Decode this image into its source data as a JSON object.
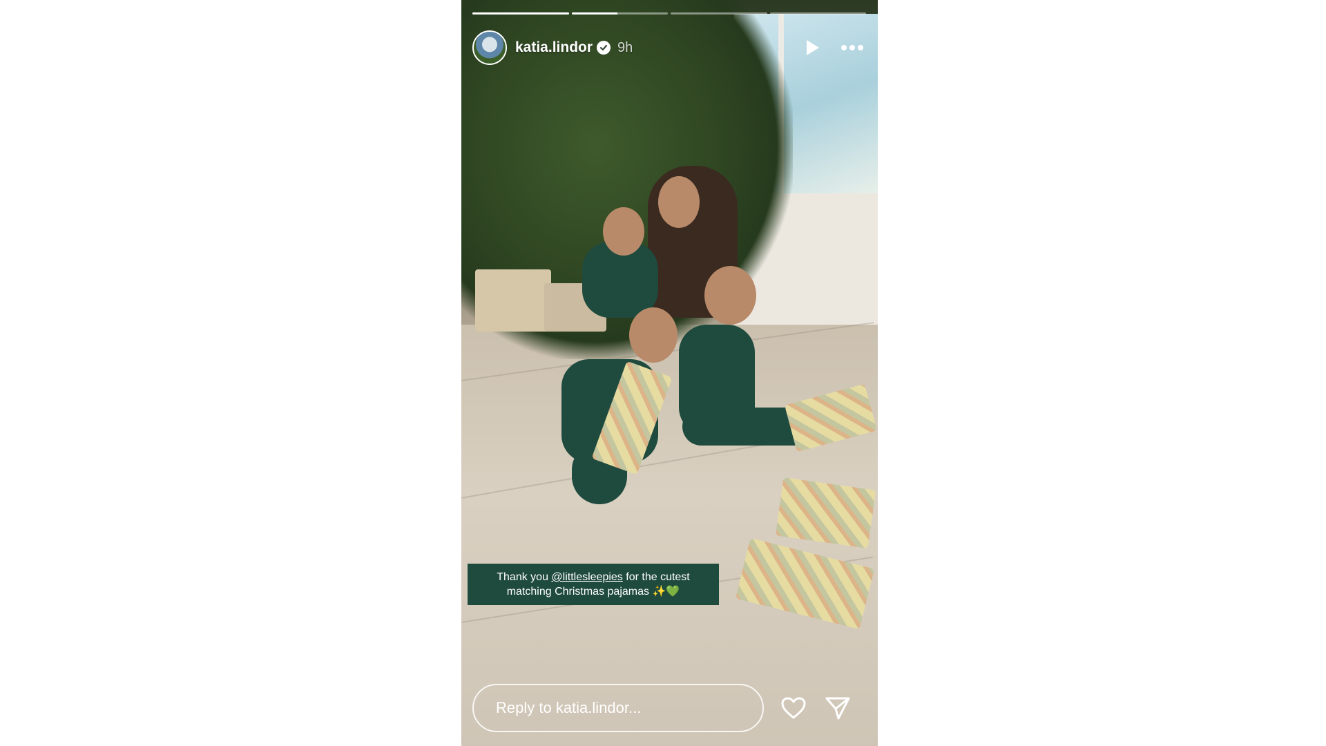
{
  "story": {
    "progress": [
      1,
      0.48,
      0,
      0
    ],
    "user": {
      "username": "katia.lindor",
      "verified": true,
      "time_ago": "9h"
    },
    "controls": {
      "play_icon": "play-icon",
      "more_icon": "more-horizontal-icon"
    },
    "caption": {
      "line1_before": "Thank you ",
      "mention": "@littlesleepies",
      "line1_after": " for the cutest",
      "line2": "matching Christmas pajamas ✨💚"
    },
    "reply": {
      "placeholder": "Reply to katia.lindor..."
    },
    "actions": {
      "like_icon": "heart-icon",
      "share_icon": "send-icon"
    },
    "colors": {
      "caption_bg": "#1f4a3e",
      "page_bg": "#ffffff"
    }
  }
}
